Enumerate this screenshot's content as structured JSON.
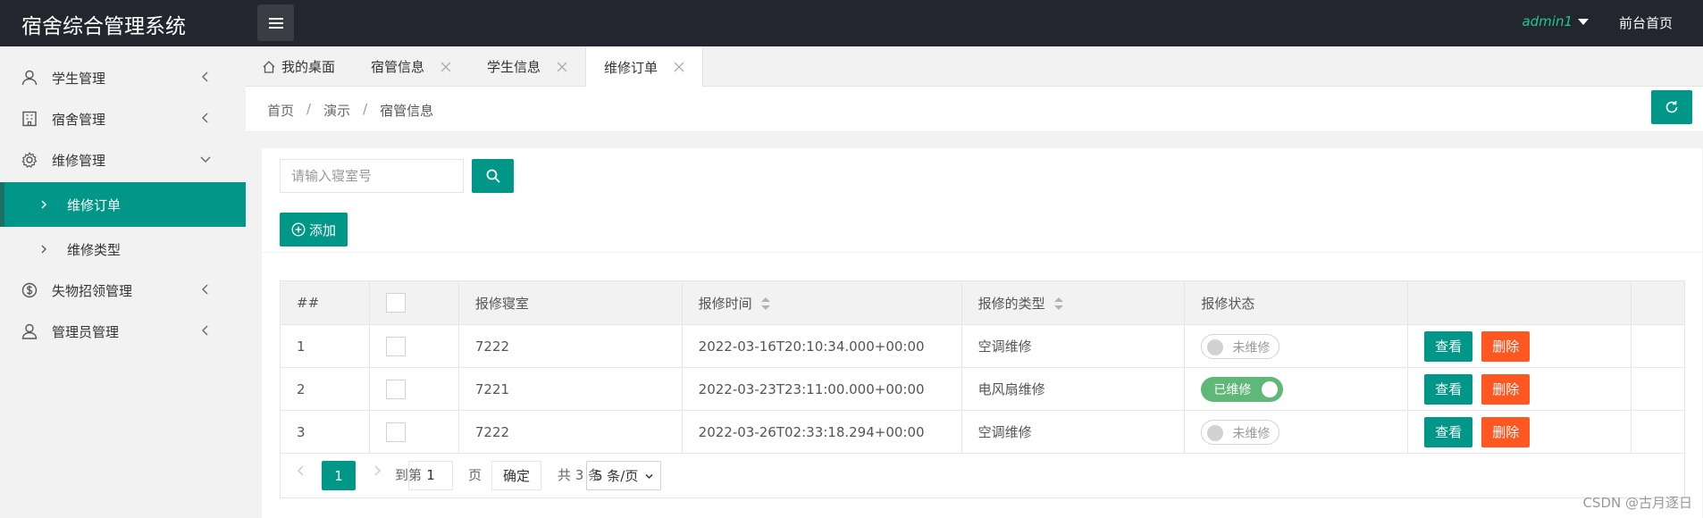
{
  "header": {
    "title": "宿舍综合管理系统",
    "user": "admin1",
    "front_link": "前台首页"
  },
  "sidebar": {
    "items": [
      {
        "label": "学生管理",
        "icon": "user-icon"
      },
      {
        "label": "宿舍管理",
        "icon": "building-icon"
      },
      {
        "label": "维修管理",
        "icon": "gear-icon"
      },
      {
        "label": "失物招领管理",
        "icon": "dollar-circle-icon"
      },
      {
        "label": "管理员管理",
        "icon": "admin-user-icon"
      }
    ],
    "sub_items": [
      {
        "label": "维修订单",
        "active": true
      },
      {
        "label": "维修类型",
        "active": false
      }
    ]
  },
  "tabs": [
    {
      "label": "我的桌面"
    },
    {
      "label": "宿管信息"
    },
    {
      "label": "学生信息"
    },
    {
      "label": "维修订单"
    }
  ],
  "breadcrumb": [
    "首页",
    "演示",
    "宿管信息"
  ],
  "breadcrumb_sep": "/",
  "search": {
    "placeholder": "请输入寝室号"
  },
  "add_label": "添加",
  "table": {
    "columns": [
      "##",
      "",
      "报修寝室",
      "报修时间",
      "报修的类型",
      "报修状态",
      "",
      ""
    ],
    "rows": [
      {
        "no": "1",
        "room": "7222",
        "time": "2022-03-16T20:10:34.000+00:00",
        "type": "空调维修",
        "status": "未维修",
        "repaired": false
      },
      {
        "no": "2",
        "room": "7221",
        "time": "2022-03-23T23:11:00.000+00:00",
        "type": "电风扇维修",
        "status": "已维修",
        "repaired": true
      },
      {
        "no": "3",
        "room": "7222",
        "time": "2022-03-26T02:33:18.294+00:00",
        "type": "空调维修",
        "status": "未维修",
        "repaired": false
      }
    ],
    "view_label": "查看",
    "delete_label": "删除"
  },
  "pagination": {
    "current": "1",
    "goto_label": "到第",
    "goto_value": "1",
    "page_label": "页",
    "confirm_label": "确定",
    "total": "共 3 条",
    "page_size": "5 条/页"
  },
  "watermark": "CSDN @古月逐日",
  "colors": {
    "accent": "#009688",
    "danger": "#ff5722",
    "success": "#5fb878",
    "header_bg": "#23262e"
  }
}
